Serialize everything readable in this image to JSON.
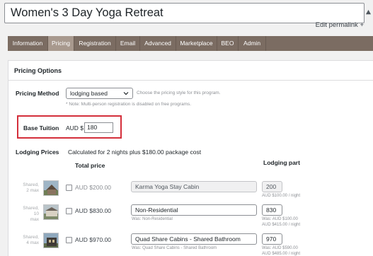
{
  "page": {
    "title": "Women's 3 Day Yoga Retreat",
    "edit_permalink": "Edit permalink +"
  },
  "tabs": [
    {
      "label": "Information",
      "active": false
    },
    {
      "label": "Pricing",
      "active": true
    },
    {
      "label": "Registration",
      "active": false
    },
    {
      "label": "Email",
      "active": false
    },
    {
      "label": "Advanced",
      "active": false
    },
    {
      "label": "Marketplace",
      "active": false
    },
    {
      "label": "BEO",
      "active": false
    },
    {
      "label": "Admin",
      "active": false
    }
  ],
  "pricing": {
    "section_title": "Pricing Options",
    "method_label": "Pricing Method",
    "method_value": "lodging based",
    "method_help": "Choose the pricing style for this program.",
    "method_note": "* Note: Multi-person registration is disabled on free programs.",
    "tuition_label": "Base Tuition",
    "tuition_currency": "AUD $",
    "tuition_value": "180",
    "lodging_label": "Lodging Prices",
    "lodging_summary": "Calculated for 2 nights plus $180.00 package cost",
    "col_total": "Total price",
    "col_part": "Lodging part",
    "rows": [
      {
        "shared": "Shared,",
        "max": "2 max",
        "price": "AUD $200.00",
        "name": "Karma Yoga Stay Cabin",
        "name_note": "",
        "part": "200",
        "part_note1": "AUD $100.00 / night",
        "part_note2": "",
        "disabled": true
      },
      {
        "shared": "Shared,",
        "max": "10",
        "max2": "max",
        "price": "AUD $830.00",
        "name": "Non-Residential",
        "name_note": "Was: Non-Residential",
        "part": "830",
        "part_note1": "Was: AUD $100.00",
        "part_note2": "AUD $415.00 / night",
        "disabled": false
      },
      {
        "shared": "Shared,",
        "max": "4 max",
        "price": "AUD $970.00",
        "name": "Quad Share Cabins - Shared Bathroom",
        "name_note": "Was: Quad Share Cabins - Shared Bathroom",
        "part": "970",
        "part_note1": "Was: AUD $590.00",
        "part_note2": "AUD $485.00 / night",
        "disabled": false
      }
    ]
  },
  "colors": {
    "tab_bar": "#7b6c62",
    "tab_active": "#a8998e",
    "highlight_border": "#d42f3b"
  },
  "icons": {
    "collapse": "triangle-up-icon",
    "select_chevron": "chevron-down-icon",
    "thumbnail": "cabin-photo-icon"
  }
}
